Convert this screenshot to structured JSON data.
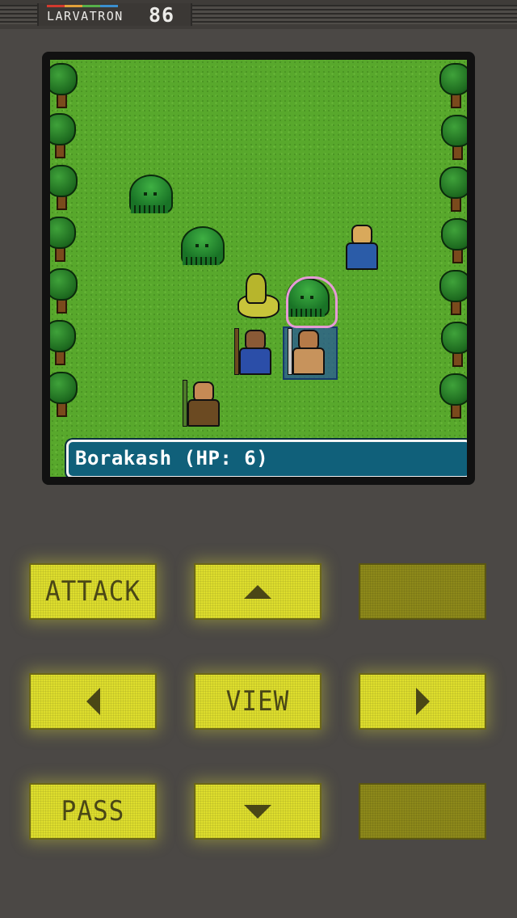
{
  "header": {
    "brand_name": "LARVATRON",
    "brand_number": "86",
    "rainbow_colors": [
      "#d23a2e",
      "#e2a03a",
      "#56b04a",
      "#3a8fd0"
    ]
  },
  "game": {
    "status_text": "Borakash (HP: 6)",
    "units": [
      {
        "type": "slime",
        "team": "enemy"
      },
      {
        "type": "slime",
        "team": "enemy"
      },
      {
        "type": "slime",
        "team": "enemy",
        "targeted": true
      },
      {
        "type": "snake",
        "team": "enemy"
      },
      {
        "type": "hero-monk",
        "team": "enemy"
      },
      {
        "type": "hero-mage",
        "team": "player"
      },
      {
        "type": "hero-warrior",
        "team": "player",
        "selected": true,
        "name": "Borakash"
      },
      {
        "type": "hero-archer",
        "team": "player"
      }
    ]
  },
  "controls": {
    "attack_label": "ATTACK",
    "view_label": "VIEW",
    "pass_label": "PASS",
    "up_icon": "arrow-up-icon",
    "down_icon": "arrow-down-icon",
    "left_icon": "arrow-left-icon",
    "right_icon": "arrow-right-icon"
  },
  "colors": {
    "button_active": "#dede2d",
    "button_disabled": "#8d891a",
    "status_bar": "#10607a",
    "grass": "#58a82c"
  }
}
